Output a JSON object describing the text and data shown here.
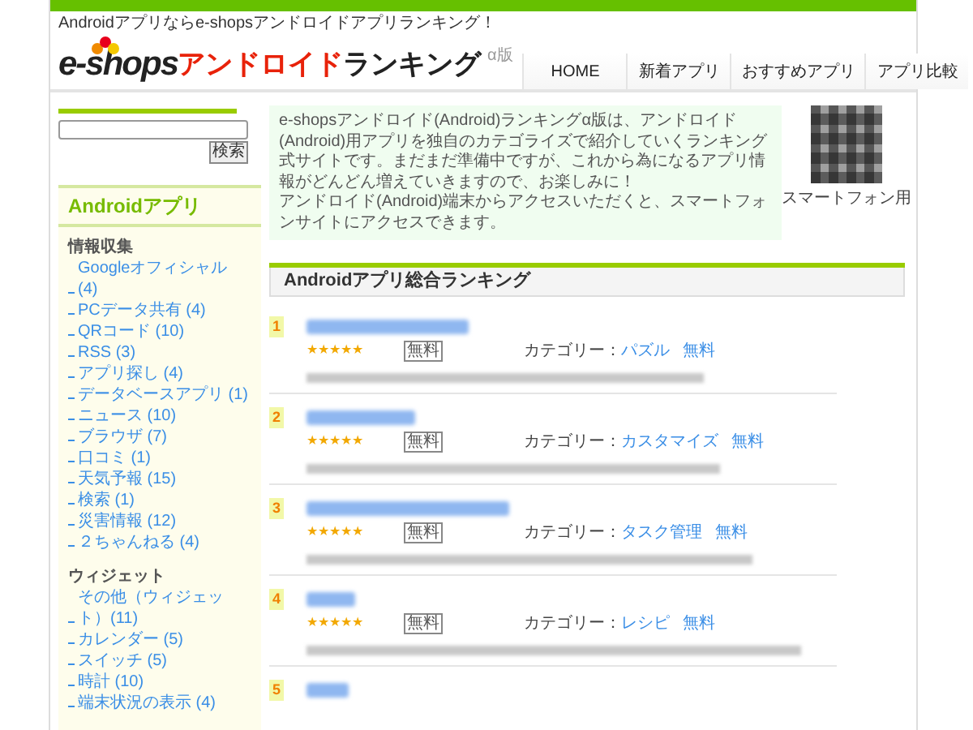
{
  "header": {
    "tagline": "Androidアプリならe-shopsアンドロイドアプリランキング！",
    "logo": {
      "brand": "e-shops",
      "accent": "アンドロイド",
      "rest": "ランキング",
      "edition": "α版"
    }
  },
  "nav": [
    {
      "label": "HOME"
    },
    {
      "label": "新着アプリ"
    },
    {
      "label": "おすすめアプリ"
    },
    {
      "label": "アプリ比較"
    }
  ],
  "search": {
    "button": "検索"
  },
  "sidebar": {
    "heading": "Androidアプリ",
    "groups": [
      {
        "title": "情報収集",
        "items": [
          "Googleオフィシャル (4)",
          "PCデータ共有 (4)",
          "QRコード (10)",
          "RSS (3)",
          "アプリ探し (4)",
          "データベースアプリ (1)",
          "ニュース (10)",
          "ブラウザ (7)",
          "口コミ (1)",
          "天気予報 (15)",
          "検索 (1)",
          "災害情報 (12)",
          "２ちゃんねる (4)"
        ]
      },
      {
        "title": "ウィジェット",
        "items": [
          "その他（ウィジェット）(11)",
          "カレンダー (5)",
          "スイッチ (5)",
          "時計 (10)",
          "端末状況の表示 (4)"
        ]
      }
    ]
  },
  "intro": {
    "paragraphs": [
      "e-shopsアンドロイド(Android)ランキングα版は、アンドロイド(Android)用アプリを独自のカテゴライズで紹介していくランキング式サイトです。まだまだ準備中ですが、これから為になるアプリ情報がどんどん増えていきますので、お楽しみに！",
      "アンドロイド(Android)端末からアクセスいただくと、スマートフォンサイトにアクセスできます。"
    ],
    "qr_caption": "スマートフォン用"
  },
  "ranking": {
    "title": "Androidアプリ総合ランキング",
    "items": [
      {
        "rank": "1",
        "stars": 5,
        "badge": "無料",
        "category_label": "カテゴリー：",
        "category": "パズル",
        "price": "無料"
      },
      {
        "rank": "2",
        "stars": 5,
        "badge": "無料",
        "category_label": "カテゴリー：",
        "category": "カスタマイズ",
        "price": "無料"
      },
      {
        "rank": "3",
        "stars": 5,
        "badge": "無料",
        "category_label": "カテゴリー：",
        "category": "タスク管理",
        "price": "無料"
      },
      {
        "rank": "4",
        "stars": 5,
        "badge": "無料",
        "category_label": "カテゴリー：",
        "category": "レシピ",
        "price": "無料"
      },
      {
        "rank": "5"
      }
    ]
  }
}
